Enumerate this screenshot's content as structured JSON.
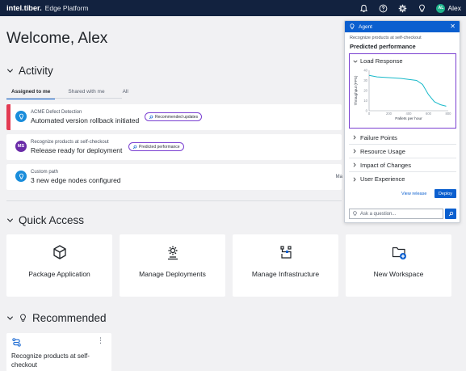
{
  "header": {
    "brand": "intel.tiber.",
    "product": "Edge Platform",
    "user": "Alex",
    "avatar_initials": "AL",
    "icons": [
      "bell-icon",
      "help-icon",
      "gear-icon",
      "bulb-icon"
    ]
  },
  "welcome": "Welcome, Alex",
  "activity": {
    "title": "Activity",
    "tabs": [
      "Assigned to me",
      "Shared with me",
      "All"
    ],
    "items": [
      {
        "sub": "ACME Defect Detection",
        "main": "Automated version rollback initiated",
        "pill": "Recommended updates",
        "right": ""
      },
      {
        "sub": "Recognize products at self-checkout",
        "main": "Release ready for deployment",
        "pill": "Predicted performance",
        "avatar": "MS",
        "right": ""
      },
      {
        "sub": "Custom path",
        "main": "3 new edge nodes configured",
        "pill": "",
        "right": "Ma"
      }
    ]
  },
  "quick_access": {
    "title": "Quick Access",
    "items": [
      {
        "label": "Package Application",
        "icon": "cube-icon"
      },
      {
        "label": "Manage Deployments",
        "icon": "gears-icon"
      },
      {
        "label": "Manage Infrastructure",
        "icon": "infrastructure-icon"
      },
      {
        "label": "New Workspace",
        "icon": "folder-plus-icon"
      }
    ]
  },
  "recommended": {
    "title": "Recommended",
    "card_title": "Recognize products at self-checkout"
  },
  "agent": {
    "title": "Agent",
    "subtitle": "Recognize products at self-checkout",
    "heading": "Predicted performance",
    "sections": {
      "load_response": "Load Response",
      "failure_points": "Failure Points",
      "resource_usage": "Resource Usage",
      "impact": "Impact of Changes",
      "user_experience": "User Experience"
    },
    "view_release": "View release",
    "deploy": "Deploy",
    "ask_placeholder": "Ask a question..."
  },
  "chart_data": {
    "type": "line",
    "title": "",
    "xlabel": "Pallets per hour",
    "ylabel": "Throughput (FPS)",
    "x_ticks": [
      "0",
      "200",
      "400",
      "600",
      "800"
    ],
    "y_ticks": [
      "40",
      "30",
      "20",
      "10",
      "0"
    ],
    "xlim": [
      0,
      800
    ],
    "ylim": [
      0,
      40
    ],
    "x": [
      0,
      80,
      160,
      240,
      320,
      400,
      480,
      540,
      600,
      660,
      720,
      780
    ],
    "y": [
      35,
      33.5,
      33,
      32.5,
      32,
      31,
      30,
      26,
      16,
      9,
      6,
      4.5
    ],
    "accent": "#17b9c9"
  }
}
